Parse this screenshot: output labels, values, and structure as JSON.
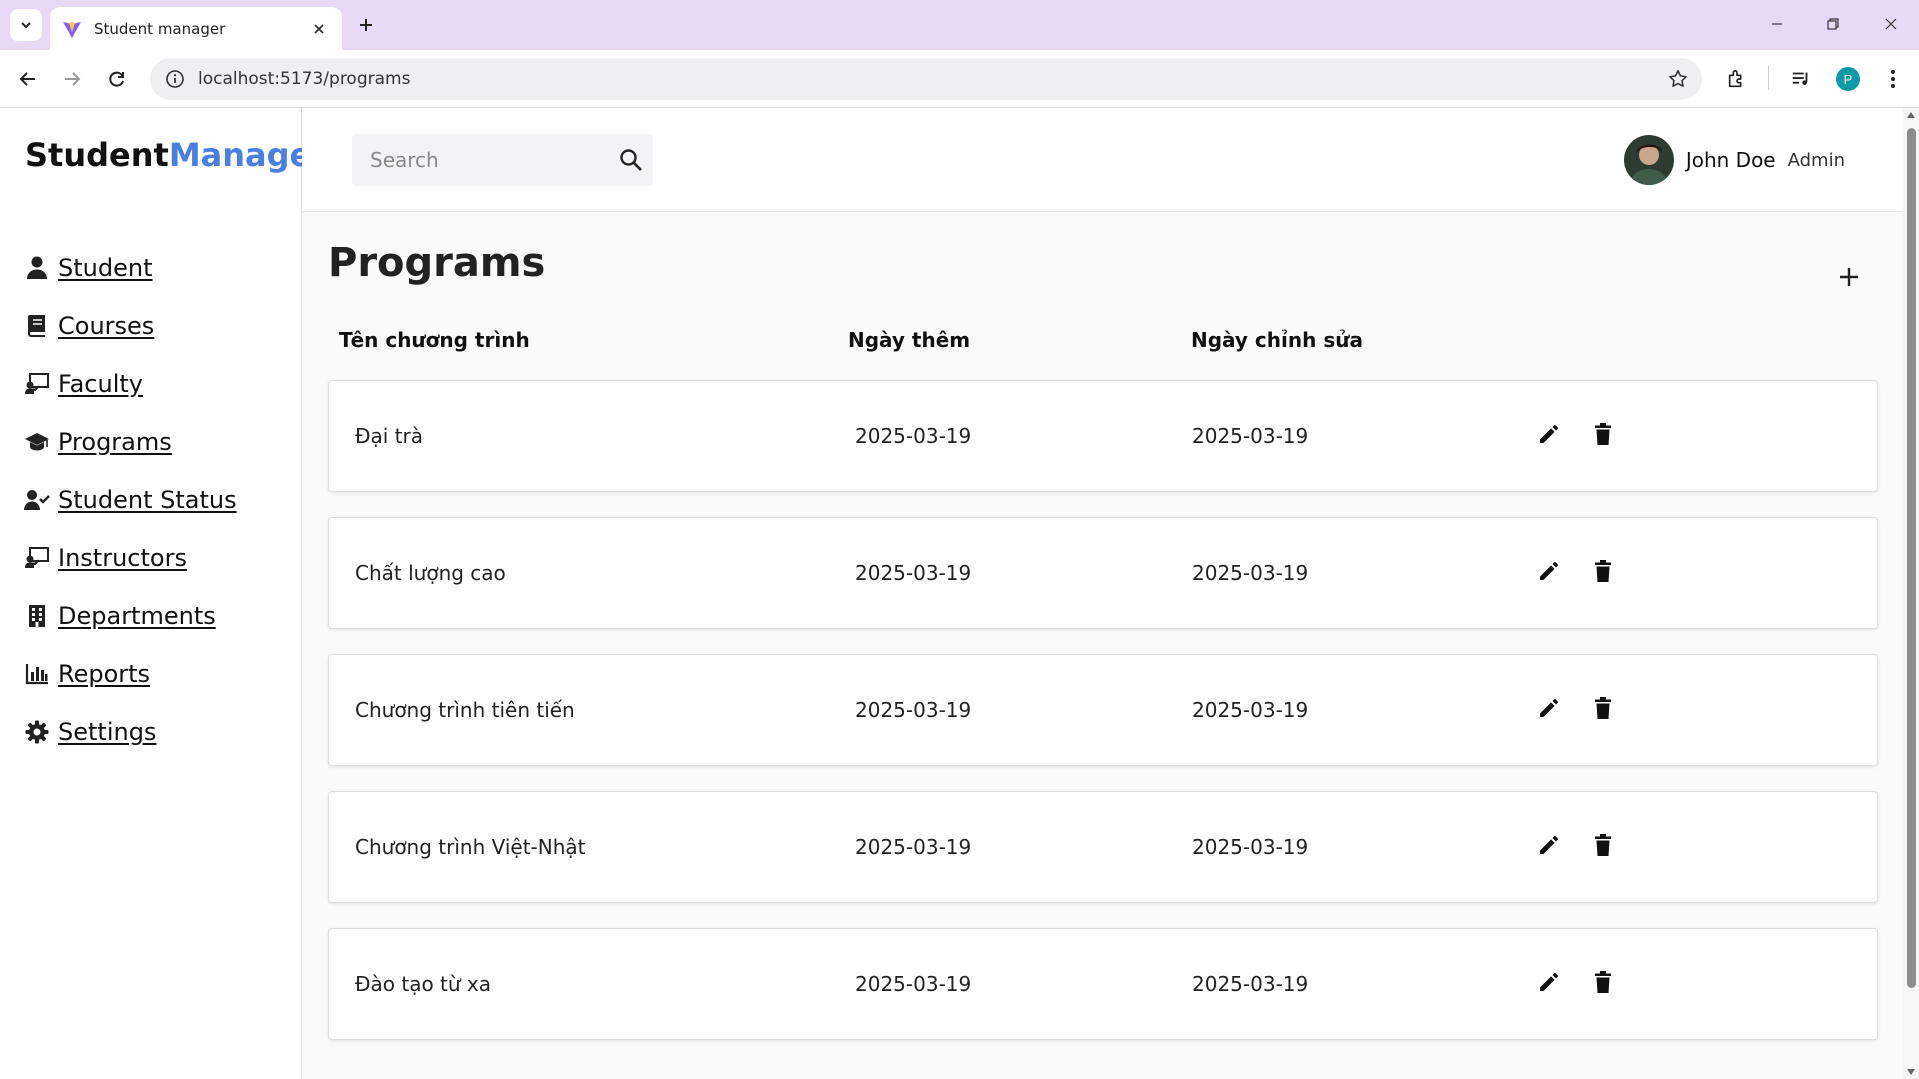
{
  "browser": {
    "tab_title": "Student manager",
    "url": "localhost:5173/programs",
    "profile_initial": "P"
  },
  "brand": {
    "part1": "Student",
    "part2": "Manager",
    "accent_color": "#4a7fe0"
  },
  "sidebar": {
    "items": [
      {
        "label": "Student",
        "icon": "user-icon"
      },
      {
        "label": "Courses",
        "icon": "book-icon"
      },
      {
        "label": "Faculty",
        "icon": "chalkboard-teacher-icon"
      },
      {
        "label": "Programs",
        "icon": "graduation-cap-icon"
      },
      {
        "label": "Student Status",
        "icon": "user-check-icon"
      },
      {
        "label": "Instructors",
        "icon": "chalkboard-teacher-icon"
      },
      {
        "label": "Departments",
        "icon": "building-icon"
      },
      {
        "label": "Reports",
        "icon": "bar-chart-icon"
      },
      {
        "label": "Settings",
        "icon": "gear-icon"
      }
    ]
  },
  "header": {
    "search_placeholder": "Search",
    "user_name": "John Doe",
    "user_role": "Admin"
  },
  "main": {
    "title": "Programs",
    "columns": {
      "name": "Tên chương trình",
      "added": "Ngày thêm",
      "edited": "Ngày chỉnh sửa"
    },
    "rows": [
      {
        "name": "Đại trà",
        "added": "2025-03-19",
        "edited": "2025-03-19"
      },
      {
        "name": "Chất lượng cao",
        "added": "2025-03-19",
        "edited": "2025-03-19"
      },
      {
        "name": "Chương trình tiên tiến",
        "added": "2025-03-19",
        "edited": "2025-03-19"
      },
      {
        "name": "Chương trình Việt-Nhật",
        "added": "2025-03-19",
        "edited": "2025-03-19"
      },
      {
        "name": "Đào tạo từ xa",
        "added": "2025-03-19",
        "edited": "2025-03-19"
      }
    ]
  }
}
